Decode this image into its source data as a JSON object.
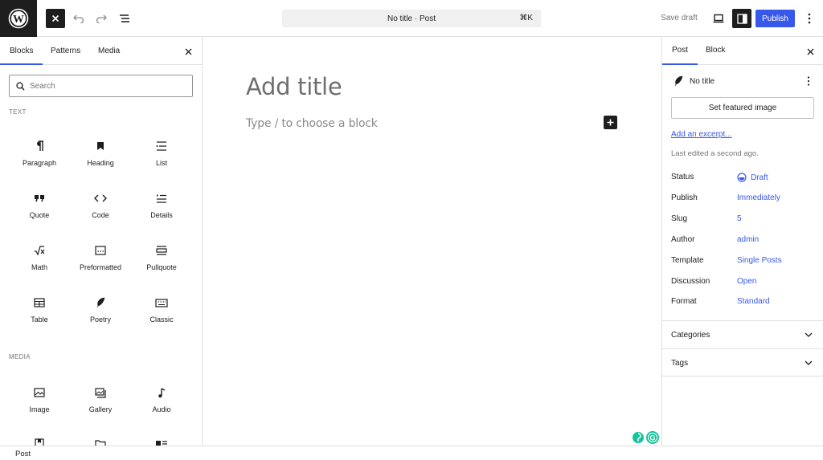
{
  "topbar": {
    "document_title": "No title · Post",
    "shortcut": "⌘K",
    "save_draft": "Save draft",
    "publish": "Publish"
  },
  "inserter": {
    "tabs": [
      "Blocks",
      "Patterns",
      "Media"
    ],
    "search_placeholder": "Search",
    "categories": {
      "text": "TEXT",
      "media": "MEDIA"
    },
    "text_blocks": [
      "Paragraph",
      "Heading",
      "List",
      "Quote",
      "Code",
      "Details",
      "Math",
      "Preformatted",
      "Pullquote",
      "Table",
      "Poetry",
      "Classic"
    ],
    "media_blocks": [
      "Image",
      "Gallery",
      "Audio"
    ]
  },
  "canvas": {
    "title_placeholder": "Add title",
    "block_placeholder": "Type / to choose a block"
  },
  "settings": {
    "tabs": [
      "Post",
      "Block"
    ],
    "post_title": "No title",
    "featured_image_button": "Set featured image",
    "excerpt_link": "Add an excerpt...",
    "last_edited": "Last edited a second ago.",
    "meta": [
      {
        "label": "Status",
        "value": "Draft"
      },
      {
        "label": "Publish",
        "value": "Immediately"
      },
      {
        "label": "Slug",
        "value": "5"
      },
      {
        "label": "Author",
        "value": "admin"
      },
      {
        "label": "Template",
        "value": "Single Posts"
      },
      {
        "label": "Discussion",
        "value": "Open"
      },
      {
        "label": "Format",
        "value": "Standard"
      }
    ],
    "panels": [
      "Categories",
      "Tags"
    ]
  },
  "footer": {
    "breadcrumb": "Post"
  },
  "colors": {
    "accent": "#3858e9",
    "dark": "#1e1e1e",
    "border": "#e0e0e0",
    "muted": "#757575",
    "grammarly": "#15c39a"
  }
}
